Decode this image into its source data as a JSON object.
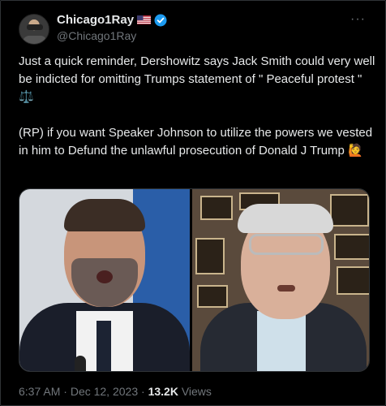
{
  "author": {
    "display_name": "Chicago1Ray",
    "handle": "@Chicago1Ray",
    "flag_icon": "us-flag-icon",
    "verified_icon": "verified-badge-icon",
    "verified_color": "#1d9bf0"
  },
  "more_label": "···",
  "tweet": {
    "text": "Just a quick reminder, Dershowitz says Jack Smith could very well be indicted for omitting Trumps statement of \" Peaceful protest \" ⚖️\n\n(RP) if you want Speaker Johnson to utilize the powers we vested in him to Defund the unlawful prosecution of Donald J Trump 🙋"
  },
  "media": {
    "left_image": "man-in-suit-photo",
    "right_image": "older-man-with-glasses-photo"
  },
  "footer": {
    "time": "6:37 AM",
    "dot1": " · ",
    "date": "Dec 12, 2023",
    "dot2": " · ",
    "views_count": "13.2K",
    "views_label": " Views"
  },
  "colors": {
    "background": "#000000",
    "text": "#e7e9ea",
    "muted": "#71767b",
    "border": "#2f3336"
  }
}
